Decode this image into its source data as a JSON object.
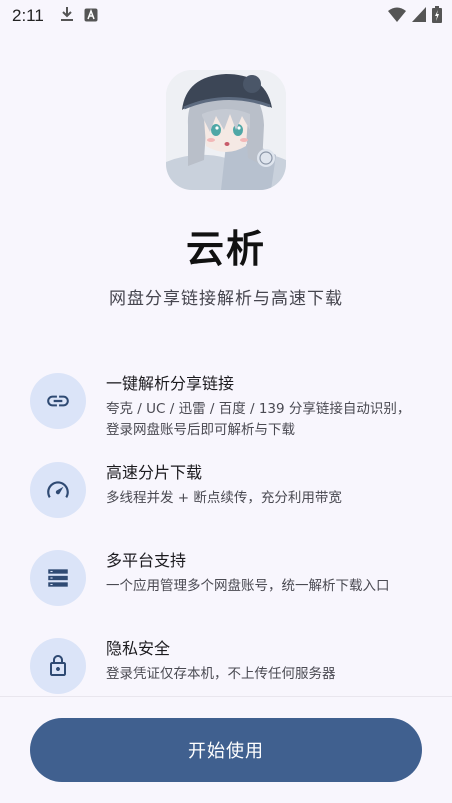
{
  "status_bar": {
    "time": "2:11",
    "icons": [
      "download-icon",
      "a-badge-icon"
    ],
    "right_icons": [
      "wifi-icon",
      "signal-icon",
      "battery-icon"
    ]
  },
  "app": {
    "name": "云析",
    "tagline": "网盘分享链接解析与高速下载"
  },
  "features": [
    {
      "icon": "link-icon",
      "title": "一键解析分享链接",
      "description": "夸克 / UC / 迅雷 / 百度 / 139 分享链接自动识别，登录网盘账号后即可解析与下载"
    },
    {
      "icon": "speedometer-icon",
      "title": "高速分片下载",
      "description": "多线程并发 + 断点续传，充分利用带宽"
    },
    {
      "icon": "storage-icon",
      "title": "多平台支持",
      "description": "一个应用管理多个网盘账号，统一解析下载入口"
    },
    {
      "icon": "lock-icon",
      "title": "隐私安全",
      "description": "登录凭证仅存本机，不上传任何服务器"
    }
  ],
  "start_button": {
    "label": "开始使用"
  },
  "colors": {
    "background": "#f8f6fd",
    "icon_circle": "#dbe4f8",
    "icon_color": "#2f4a73",
    "primary_button": "#40608f"
  }
}
